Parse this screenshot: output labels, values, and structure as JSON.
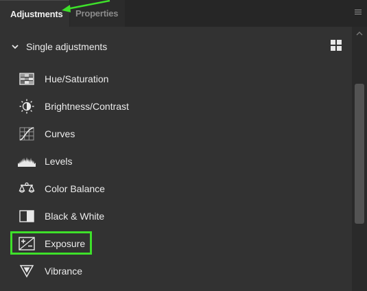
{
  "tabs": [
    {
      "label": "Adjustments",
      "active": true
    },
    {
      "label": "Properties",
      "active": false
    }
  ],
  "panel_menu_icon": "hamburger-icon",
  "section": {
    "title": "Single adjustments",
    "expanded": true,
    "view_toggle_icon": "grid-view-icon"
  },
  "items": [
    {
      "label": "Hue/Saturation",
      "icon": "hue-saturation-icon"
    },
    {
      "label": "Brightness/Contrast",
      "icon": "brightness-contrast-icon"
    },
    {
      "label": "Curves",
      "icon": "curves-icon"
    },
    {
      "label": "Levels",
      "icon": "levels-icon"
    },
    {
      "label": "Color Balance",
      "icon": "color-balance-icon"
    },
    {
      "label": "Black & White",
      "icon": "black-white-icon"
    },
    {
      "label": "Exposure",
      "icon": "exposure-icon",
      "highlighted": true
    },
    {
      "label": "Vibrance",
      "icon": "vibrance-icon"
    }
  ],
  "colors": {
    "background": "#323232",
    "tabbar": "#262626",
    "highlight": "#3ee02a",
    "text": "#ececec",
    "inactive_text": "#8a8a8a"
  }
}
